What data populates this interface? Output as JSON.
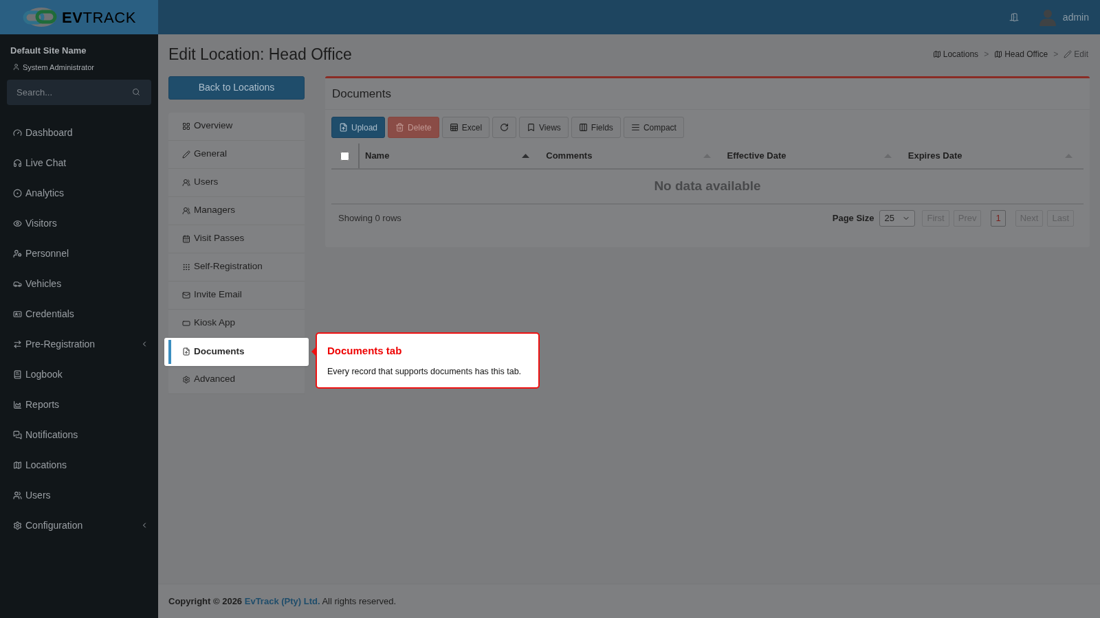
{
  "header": {
    "logo": "**EV**TRACK",
    "user": "admin"
  },
  "sidebar": {
    "site_name": "Default Site Name",
    "role": "System Administrator",
    "search": {
      "placeholder": "Search..."
    },
    "items": [
      {
        "label": "Dashboard",
        "has_submenu": false
      },
      {
        "label": "Live Chat",
        "has_submenu": false
      },
      {
        "label": "Analytics",
        "has_submenu": false
      },
      {
        "label": "Visitors",
        "has_submenu": false
      },
      {
        "label": "Personnel",
        "has_submenu": false
      },
      {
        "label": "Vehicles",
        "has_submenu": false
      },
      {
        "label": "Credentials",
        "has_submenu": false
      },
      {
        "label": "Pre-Registration",
        "has_submenu": true
      },
      {
        "label": "Logbook",
        "has_submenu": false
      },
      {
        "label": "Reports",
        "has_submenu": false
      },
      {
        "label": "Notifications",
        "has_submenu": false
      },
      {
        "label": "Locations",
        "has_submenu": false
      },
      {
        "label": "Users",
        "has_submenu": false
      },
      {
        "label": "Configuration",
        "has_submenu": true
      }
    ]
  },
  "page_title": "Edit Location: Head Office",
  "breadcrumbs": [
    {
      "label": "Locations"
    },
    {
      "label": "Head Office",
      "separator": ">"
    },
    {
      "label": "Edit",
      "separator": ">"
    }
  ],
  "back_button": "Back to Locations",
  "tabs": [
    {
      "label": "Overview",
      "selected": false
    },
    {
      "label": "General",
      "selected": false
    },
    {
      "label": "Users",
      "selected": false
    },
    {
      "label": "Managers",
      "selected": false
    },
    {
      "label": "Visit Passes",
      "selected": false
    },
    {
      "label": "Self-Registration",
      "selected": false
    },
    {
      "label": "Invite Email",
      "selected": false
    },
    {
      "label": "Kiosk App",
      "selected": false
    },
    {
      "label": "Documents",
      "selected": true
    },
    {
      "label": "Advanced",
      "selected": false
    }
  ],
  "tooltip": {
    "title": "Documents tab",
    "text": "Every record that supports documents has this tab."
  },
  "panel": {
    "title": "Documents",
    "toolbar": [
      {
        "kind": "primary",
        "label": "Upload"
      },
      {
        "kind": "danger",
        "label": "Delete"
      },
      {
        "kind": "default",
        "label": "Excel"
      },
      {
        "kind": "icon"
      },
      {
        "kind": "default",
        "label": "Views"
      },
      {
        "kind": "default",
        "label": "Fields"
      },
      {
        "kind": "default",
        "label": "Compact"
      }
    ],
    "table": {
      "select_all": {
        "checked": false
      },
      "columns": [
        {
          "label": "Name",
          "sorted": true
        },
        {
          "label": "Comments",
          "sorted": false
        },
        {
          "label": "Effective Date",
          "sorted": false
        },
        {
          "label": "Expires Date",
          "sorted": false
        }
      ],
      "empty_text": "No data available"
    },
    "row_count": "Showing 0 rows",
    "page_size_label": "Page Size",
    "page_size": "25",
    "nav_before": [
      {
        "label": "First",
        "disabled": true
      },
      {
        "label": "Prev",
        "disabled": true
      }
    ],
    "pages": [
      {
        "label": "1",
        "selected": true
      }
    ],
    "nav_after": [
      {
        "label": "Next",
        "disabled": true
      },
      {
        "label": "Last",
        "disabled": true
      }
    ]
  },
  "footer": {
    "prefix": "Copyright © 2026",
    "link": "EvTrack (Pty) Ltd.",
    "suffix": "All rights reserved."
  }
}
